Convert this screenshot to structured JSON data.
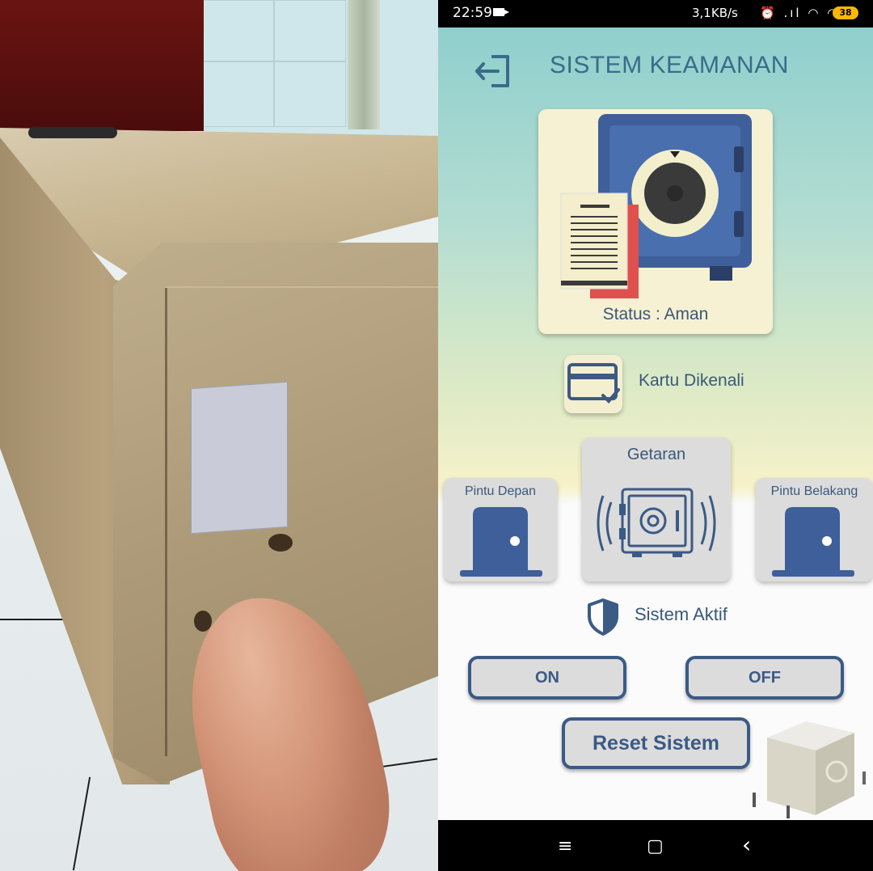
{
  "statusbar": {
    "time": "22:59",
    "net_speed": "3,1KB/s",
    "icons": "⏰ .ıl ◠ ◠",
    "battery": "38"
  },
  "app": {
    "title": "SISTEM KEAMANAN",
    "status_label": "Status :  Aman",
    "card_status": "Kartu Dikenali",
    "panels": {
      "front_door": "Pintu Depan",
      "vibration": "Getaran",
      "back_door": "Pintu Belakang"
    },
    "system_status": "Sistem Aktif",
    "buttons": {
      "on": "ON",
      "off": "OFF",
      "reset": "Reset Sistem"
    }
  },
  "navbar": {
    "menu": "≡",
    "home": "▢",
    "back": "‹"
  },
  "colors": {
    "accent": "#3b5a85",
    "title": "#3b6b8a",
    "card_bg": "#f6f1d2",
    "panel_bg": "#dcdcdc"
  }
}
